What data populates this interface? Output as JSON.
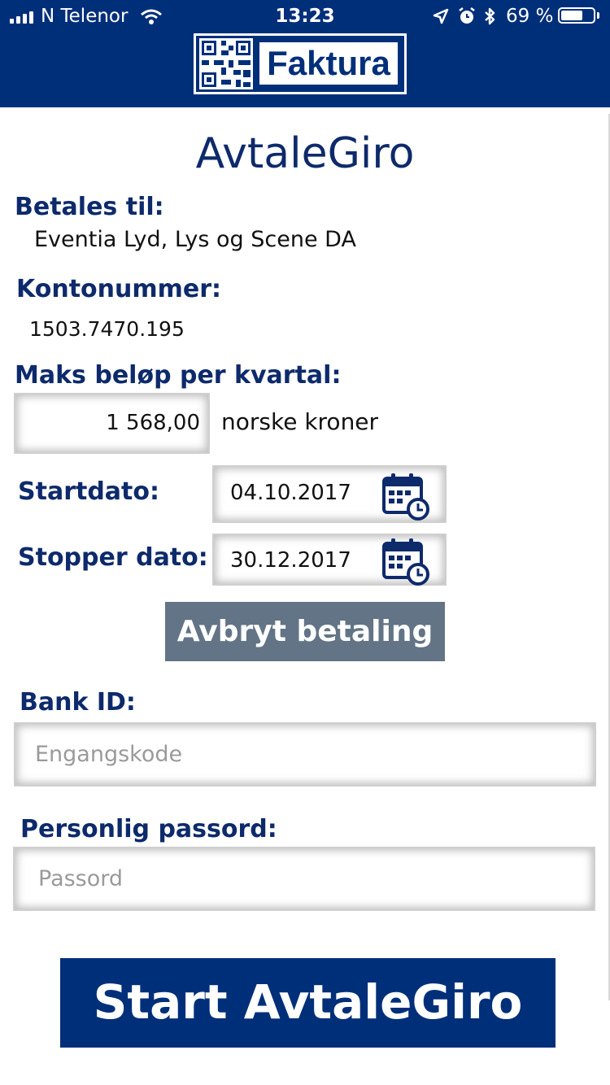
{
  "status_bar": {
    "carrier": "N Telenor",
    "time": "13:23",
    "battery_percent": "69 %",
    "battery_level": 0.69
  },
  "header": {
    "logo_text": "Faktura"
  },
  "form": {
    "title": "AvtaleGiro",
    "payee_label": "Betales til:",
    "payee_value": "Eventia Lyd, Lys og Scene DA",
    "account_label": "Kontonummer:",
    "account_value": "1503.7470.195",
    "max_amount_label": "Maks beløp per kvartal:",
    "max_amount_value": "1 568,00",
    "currency_text": "norske kroner",
    "start_label": "Startdato:",
    "start_value": "04.10.2017",
    "stop_label": "Stopper dato:",
    "stop_value": "30.12.2017",
    "cancel_button": "Avbryt betaling",
    "bankid_label": "Bank ID:",
    "bankid_placeholder": "Engangskode",
    "password_label": "Personlig passord:",
    "password_placeholder": "Passord",
    "start_button": "Start AvtaleGiro"
  }
}
